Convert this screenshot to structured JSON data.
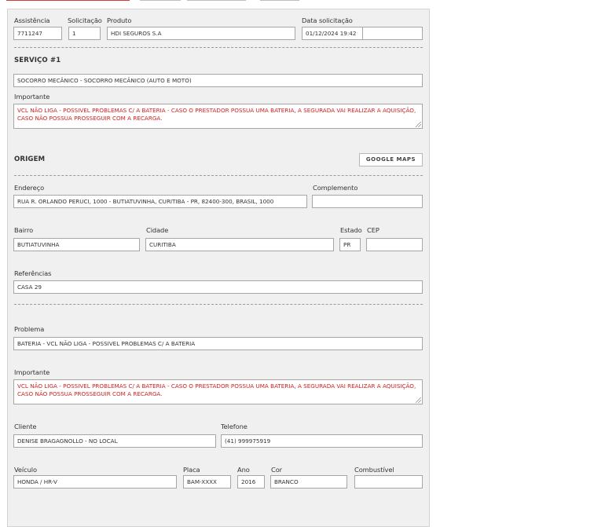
{
  "header": {
    "assistencia_label": "Assistência",
    "assistencia_value": "7711247",
    "solicitacao_label": "Solicitação",
    "solicitacao_value": "1",
    "produto_label": "Produto",
    "produto_value": "HDI SEGUROS S.A",
    "data_label": "Data solicitação",
    "data_value": "01/12/2024 19:42",
    "data_extra_value": ""
  },
  "servico": {
    "title": "SERVIÇO #1",
    "value": "SOCORRO MECÂNICO - SOCORRO MECÂNICO (AUTO E MOTO)",
    "importante_label": "Importante",
    "importante_value": "VCL NÃO LIGA - POSSIVEL PROBLEMAS C/ A BATERIA - CASO O PRESTADOR POSSUA UMA BATERIA, A SEGURADA VAI REALIZAR A AQUISIÇÃO, CASO NÃO POSSUA PROSSEGUIR COM A RECARGA."
  },
  "origem": {
    "title": "ORIGEM",
    "google_maps_label": "GOOGLE MAPS",
    "endereco_label": "Endereço",
    "endereco_value": "RUA R. ORLANDO PERUCI, 1000 - BUTIATUVINHA, CURITIBA - PR, 82400-300, BRASIL, 1000",
    "complemento_label": "Complemento",
    "complemento_value": "",
    "bairro_label": "Bairro",
    "bairro_value": "BUTIATUVINHA",
    "cidade_label": "Cidade",
    "cidade_value": "CURITIBA",
    "estado_label": "Estado",
    "estado_value": "PR",
    "cep_label": "CEP",
    "cep_value": "",
    "referencias_label": "Referências",
    "referencias_value": "CASA 29"
  },
  "detalhes": {
    "problema_label": "Problema",
    "problema_value": "BATERIA - VCL NÃO LIGA - POSSIVEL PROBLEMAS C/ A BATERIA",
    "importante_label": "Importante",
    "importante_value": "VCL NÃO LIGA - POSSIVEL PROBLEMAS C/ A BATERIA - CASO O PRESTADOR POSSUA UMA BATERIA, A SEGURADA VAI REALIZAR A AQUISIÇÃO, CASO NÃO POSSUA PROSSEGUIR COM A RECARGA.",
    "cliente_label": "Cliente",
    "cliente_value": "DENISE BRAGAGNOLLO - NO LOCAL",
    "telefone_label": "Telefone",
    "telefone_value": "(41) 999975919",
    "veiculo_label": "Veículo",
    "veiculo_value": "HONDA / HR-V",
    "placa_label": "Placa",
    "placa_value": "BAM-XXXX",
    "ano_label": "Ano",
    "ano_value": "2016",
    "cor_label": "Cor",
    "cor_value": "BRANCO",
    "combustivel_label": "Combustível",
    "combustivel_value": ""
  },
  "colors": {
    "panel_bg": "#f0f0f0",
    "warning_text": "#d21f1f",
    "accent_border": "#d23b3b"
  }
}
